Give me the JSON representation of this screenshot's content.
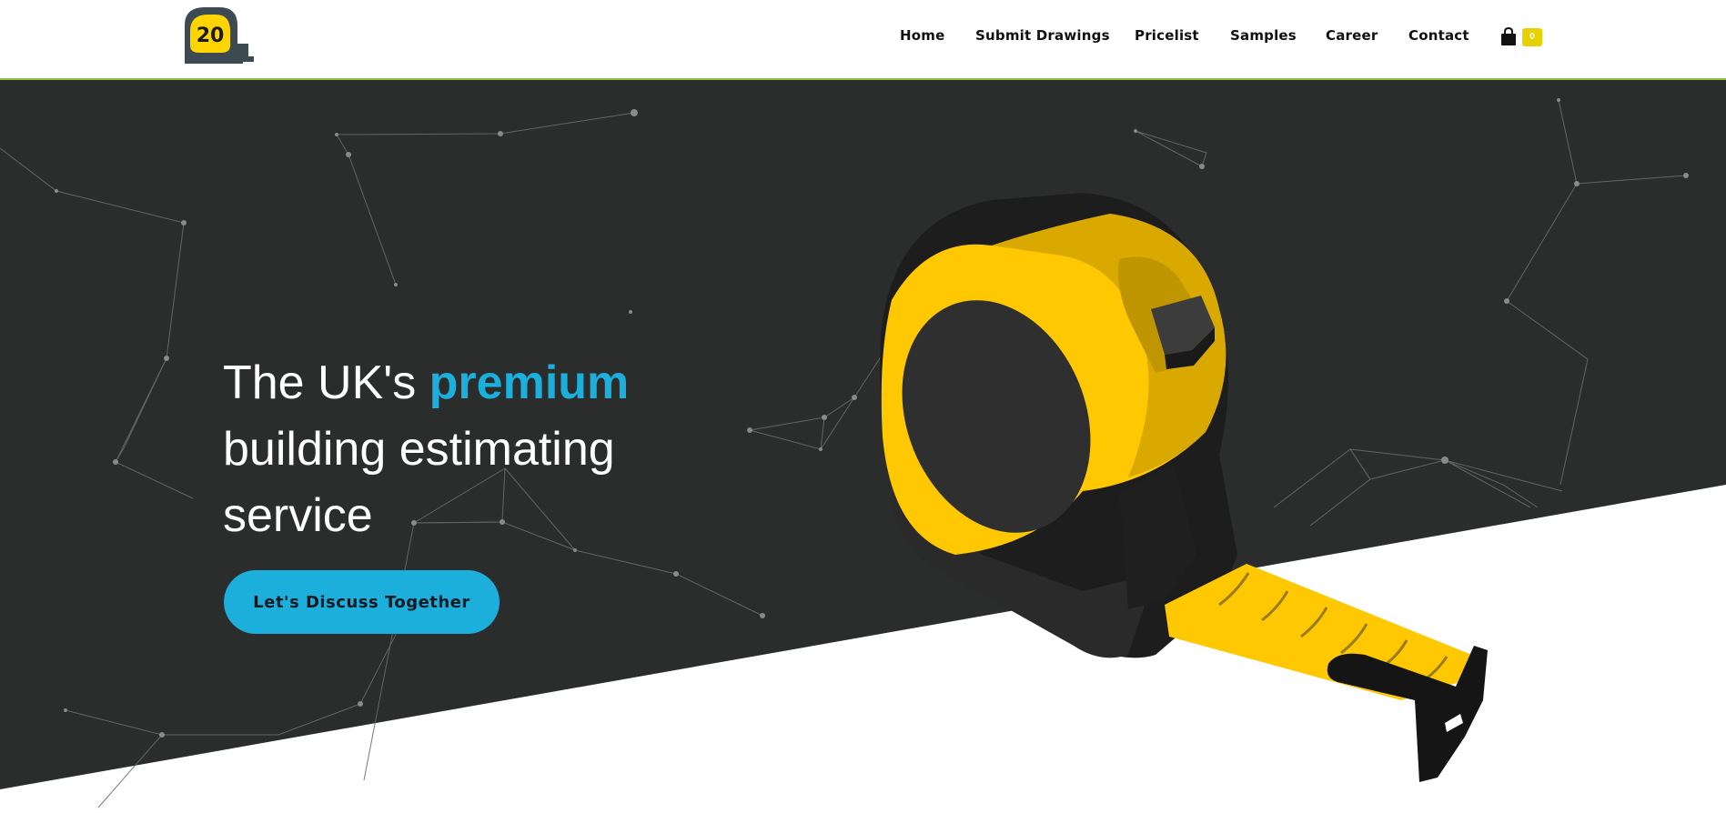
{
  "header": {
    "logo": {
      "number": "20",
      "icon": "tape-measure-logo-icon"
    },
    "nav": [
      {
        "label": "Home"
      },
      {
        "label": "Submit Drawings"
      },
      {
        "label": "Pricelist"
      },
      {
        "label": "Samples"
      },
      {
        "label": "Career"
      },
      {
        "label": "Contact"
      }
    ],
    "cart": {
      "icon": "shopping-bag-icon",
      "count": "0"
    }
  },
  "hero": {
    "headline_pre": "The UK's ",
    "headline_accent": "premium",
    "headline_post": "building estimating service",
    "cta_label": "Let's Discuss Together",
    "illustration": "tape-measure-illustration"
  },
  "colors": {
    "hero_bg": "#2b2c2c",
    "accent_blue": "#1cafdc",
    "tape_yellow": "#ffc800",
    "header_border": "#8cc63f",
    "badge": "#e6d200"
  }
}
